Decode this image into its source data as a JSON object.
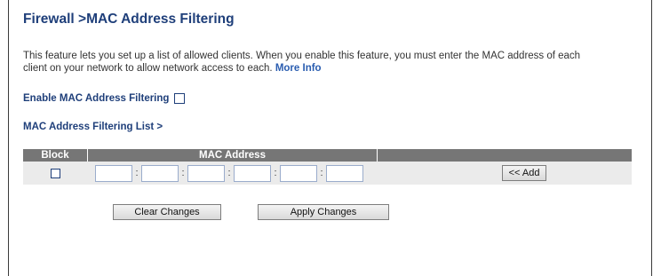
{
  "page": {
    "title": "Firewall >MAC Address Filtering",
    "description": "This feature lets you set up a list of allowed clients. When you enable this feature, you must enter the MAC address of each client on your network to allow network access to each.",
    "more_info": "More Info"
  },
  "enable": {
    "label": "Enable MAC Address Filtering",
    "checked": false
  },
  "list": {
    "title": "MAC Address Filtering List >",
    "columns": [
      "Block",
      "MAC Address",
      ""
    ],
    "row": {
      "block_checked": false,
      "mac_octets": [
        "",
        "",
        "",
        "",
        "",
        ""
      ],
      "separator": ":",
      "add_label": "<< Add"
    }
  },
  "buttons": {
    "clear": "Clear Changes",
    "apply": "Apply Changes"
  }
}
